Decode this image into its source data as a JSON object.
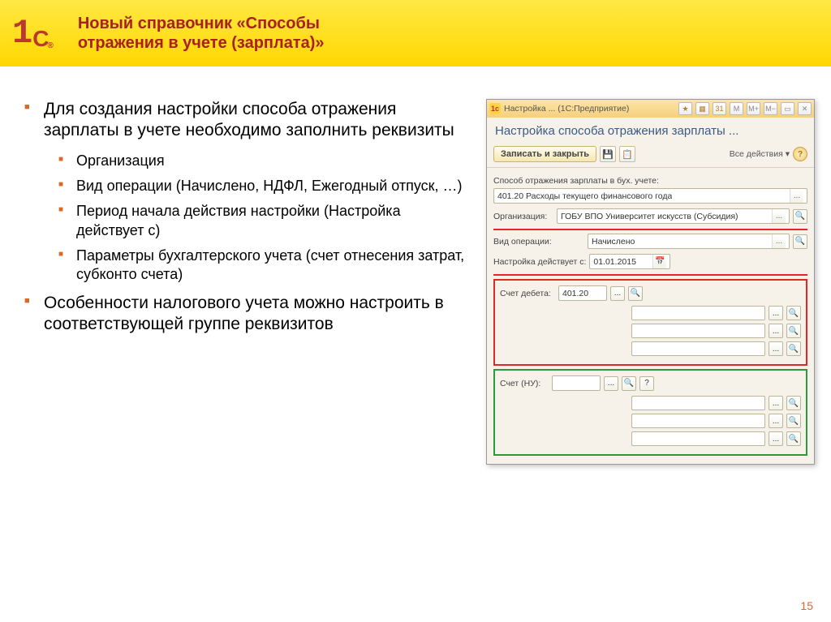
{
  "header": {
    "logo_digit": "1",
    "logo_brand": "C",
    "logo_r": "®",
    "title_l1": "Новый справочник «Способы",
    "title_l2": "отражения в учете (зарплата)»"
  },
  "bullets": {
    "b1": "Для создания настройки способа отражения зарплаты в учете необходимо заполнить реквизиты",
    "s1": "Организация",
    "s2": "Вид операции (Начислено, НДФЛ, Ежегодный отпуск, …)",
    "s3": "Период начала действия настройки (Настройка действует с)",
    "s4": "Параметры бухгалтерского учета (счет отнесения затрат, субконто счета)",
    "b2": "Особенности налогового учета можно настроить в соответствующей группе реквизитов"
  },
  "win": {
    "title": "Настройка ...  (1С:Предприятие)",
    "m": "M",
    "mplus": "M+",
    "mminus": "M−",
    "heading": "Настройка способа отражения зарплаты ...",
    "save_close": "Записать и закрыть",
    "all_actions": "Все действия ▾",
    "label_method": "Способ отражения зарплаты в бух. учете:",
    "method_value": "401.20 Расходы текущего финансового года",
    "label_org": "Организация:",
    "org_value": "ГОБУ ВПО Университет искусств (Субсидия)",
    "label_op": "Вид операции:",
    "op_value": "Начислено",
    "label_from": "Настройка действует с:",
    "date_value": "01.01.2015",
    "label_debit": "Счет дебета:",
    "debit_value": "401.20",
    "label_nu": "Счет (НУ):",
    "ellipsis": "...",
    "help": "?"
  },
  "page_number": "15"
}
